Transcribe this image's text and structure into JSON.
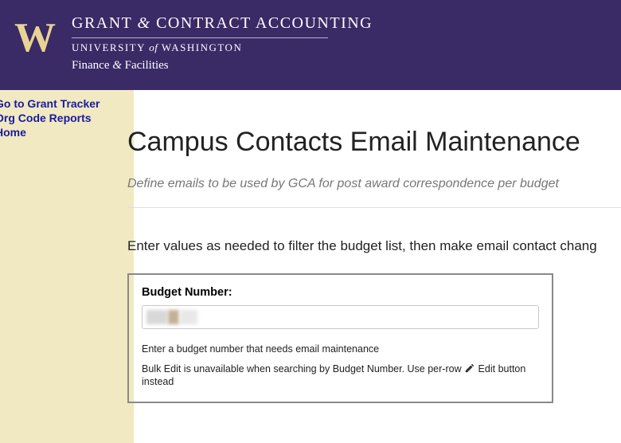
{
  "header": {
    "logo_letter": "W",
    "dept_title_pre": "GRANT ",
    "dept_title_amp": "&",
    "dept_title_post": " CONTRACT ACCOUNTING",
    "univ_pre": "UNIVERSITY ",
    "univ_of": "of",
    "univ_post": " WASHINGTON",
    "subunit_pre": "Finance ",
    "subunit_amp": "&",
    "subunit_post": " Facilities"
  },
  "sidebar": {
    "items": [
      {
        "label": "Go to Grant Tracker"
      },
      {
        "label": "Org Code Reports"
      },
      {
        "label": "Home"
      }
    ]
  },
  "main": {
    "title": "Campus Contacts Email Maintenance",
    "subtitle": "Define emails to be used by GCA for post award correspondence per budget",
    "instruction": "Enter values as needed to filter the budget list, then make email contact chang",
    "panel": {
      "label": "Budget Number:",
      "input_value": "",
      "hint": "Enter a budget number that needs email maintenance",
      "bulk_pre": "Bulk Edit is unavailable when searching by Budget Number. Use per-row ",
      "bulk_post": " Edit button instead"
    }
  }
}
